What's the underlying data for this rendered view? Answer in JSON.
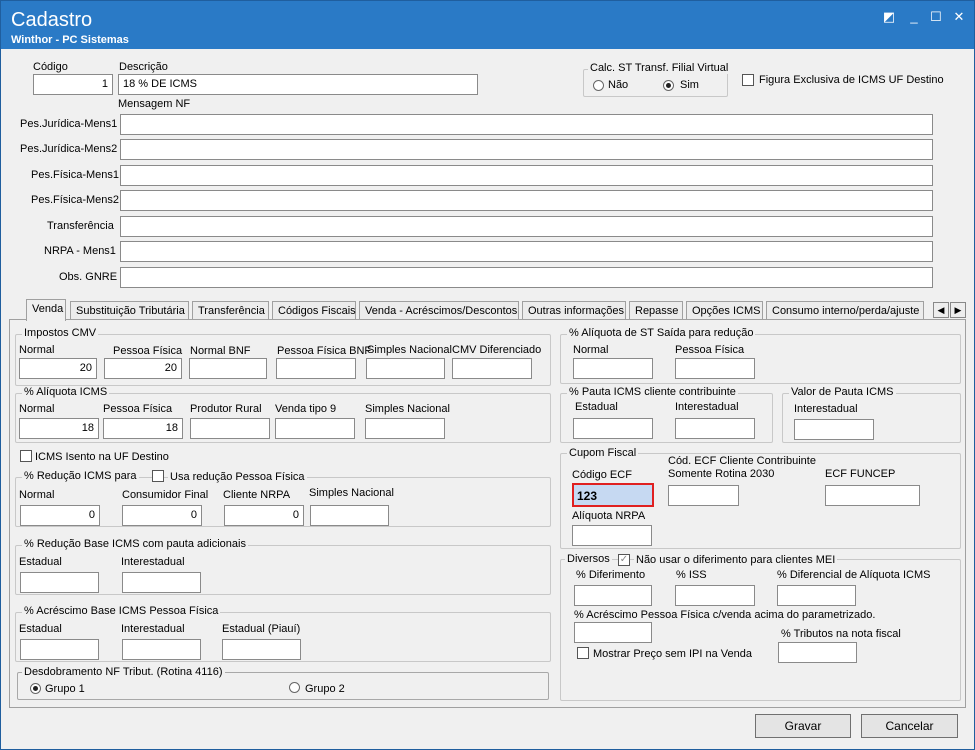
{
  "window": {
    "title": "Cadastro",
    "subtitle": "Winthor - PC Sistemas"
  },
  "header": {
    "codigo_label": "Código",
    "codigo_value": "1",
    "descricao_label": "Descrição",
    "descricao_value": "18 % DE ICMS",
    "calc_st_title": "Calc. ST Transf. Filial Virtual",
    "opt_nao": "Não",
    "opt_sim": "Sim",
    "figura_exclusiva": "Figura Exclusiva de ICMS UF Destino",
    "mensagem_nf": "Mensagem NF",
    "msg_rows": [
      "Pes.Jurídica-Mens1",
      "Pes.Jurídica-Mens2",
      "Pes.Física-Mens1",
      "Pes.Física-Mens2",
      "Transferência",
      "NRPA - Mens1",
      "Obs. GNRE"
    ]
  },
  "tabs": [
    "Venda",
    "Substituição Tributária",
    "Transferência",
    "Códigos Fiscais",
    "Venda - Acréscimos/Descontos",
    "Outras informações",
    "Repasse",
    "Opções ICMS",
    "Consumo interno/perda/ajuste"
  ],
  "left": {
    "impostos_cmv": {
      "title": "Impostos CMV",
      "labels": [
        "Normal",
        "Pessoa Física",
        "Normal BNF",
        "Pessoa Física BNF",
        "Simples Nacional",
        "CMV Diferenciado"
      ],
      "values": [
        "20",
        "20",
        "",
        "",
        "",
        ""
      ]
    },
    "aliquota_icms": {
      "title": "% Alíquota ICMS",
      "labels": [
        "Normal",
        "Pessoa Física",
        "Produtor Rural",
        "Venda tipo 9",
        "Simples Nacional"
      ],
      "values": [
        "18",
        "18",
        "",
        "",
        ""
      ]
    },
    "icms_isento": "ICMS Isento na UF Destino",
    "reducao": {
      "title": "% Redução ICMS para",
      "usa_reducao": "Usa redução Pessoa Física",
      "labels": [
        "Normal",
        "Consumidor Final",
        "Cliente NRPA",
        "Simples Nacional"
      ],
      "values": [
        "0",
        "0",
        "0",
        ""
      ]
    },
    "reducao_base": {
      "title": "% Redução Base ICMS com pauta adicionais",
      "labels": [
        "Estadual",
        "Interestadual"
      ]
    },
    "acrescimo_base": {
      "title": "% Acréscimo Base ICMS Pessoa Física",
      "labels": [
        "Estadual",
        "Interestadual",
        "Estadual (Piauí)"
      ]
    },
    "desdobramento": {
      "title": "Desdobramento NF Tribut. (Rotina 4116)",
      "opt1": "Grupo 1",
      "opt2": "Grupo 2"
    }
  },
  "right": {
    "aliq_st": {
      "title": "% Alíquota de ST Saída para redução",
      "labels": [
        "Normal",
        "Pessoa Física"
      ]
    },
    "pauta": {
      "title": "% Pauta ICMS cliente contribuinte",
      "labels": [
        "Estadual",
        "Interestadual"
      ]
    },
    "valor_pauta": {
      "title": "Valor de Pauta ICMS",
      "labels": [
        "Interestadual"
      ]
    },
    "cupom": {
      "title": "Cupom Fiscal",
      "codigo_ecf": "Código ECF",
      "codigo_ecf_value": "123",
      "cod_ecf_cliente_1": "Cód. ECF Cliente Contribuinte",
      "cod_ecf_cliente_2": "Somente Rotina 2030",
      "ecf_funcep": "ECF FUNCEP",
      "aliquota_nrpa": "Alíquota NRPA"
    },
    "diversos": {
      "title": "Diversos",
      "nao_usar": "Não usar o diferimento para clientes MEI",
      "labels": [
        "% Diferimento",
        "% ISS",
        "% Diferencial de Alíquota ICMS"
      ],
      "acrescimo_pf": "% Acréscimo Pessoa Física c/venda acima do parametrizado.",
      "tributos": "% Tributos na nota fiscal",
      "mostrar_preco": "Mostrar Preço sem IPI na Venda"
    }
  },
  "buttons": {
    "gravar": "Gravar",
    "cancelar": "Cancelar"
  }
}
